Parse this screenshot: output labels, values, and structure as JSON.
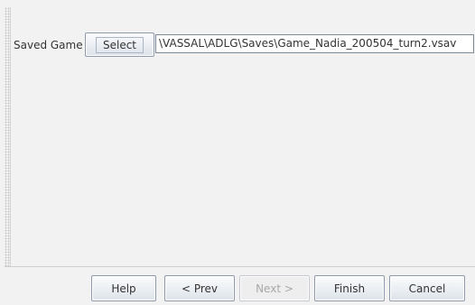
{
  "form": {
    "saved_game_label": "Saved Game",
    "select_button_label": "Select",
    "path_value": "\\VASSAL\\ADLG\\Saves\\Game_Nadia_200504_turn2.vsav"
  },
  "buttons": {
    "help": "Help",
    "prev": "< Prev",
    "next": "Next >",
    "finish": "Finish",
    "cancel": "Cancel"
  }
}
